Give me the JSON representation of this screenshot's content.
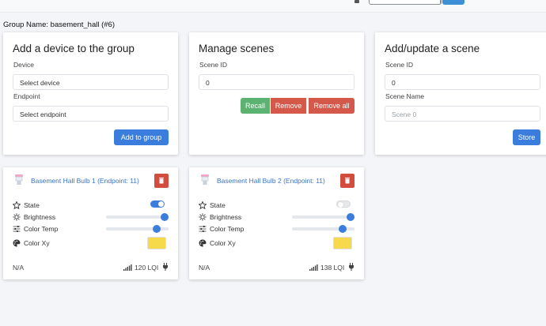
{
  "group_name": "Group Name: basement_hall (#6)",
  "add_device": {
    "title": "Add a device to the group",
    "device_label": "Device",
    "device_value": "Select device",
    "endpoint_label": "Endpoint",
    "endpoint_value": "Select endpoint",
    "button": "Add to group"
  },
  "manage_scenes": {
    "title": "Manage scenes",
    "scene_id_label": "Scene ID",
    "scene_id_value": "0",
    "recall": "Recall",
    "remove": "Remove",
    "remove_all": "Remove all"
  },
  "update_scene": {
    "title": "Add/update a scene",
    "scene_id_label": "Scene ID",
    "scene_id_value": "0",
    "scene_name_label": "Scene Name",
    "scene_name_placeholder": "Scene 0",
    "button": "Store"
  },
  "devices": [
    {
      "title": "Basement Hall Bulb 1 (Endpoint: 11)",
      "state_label": "State",
      "state_on": true,
      "brightness_label": "Brightness",
      "brightness": 1.0,
      "color_temp_label": "Color Temp",
      "color_temp": 0.86,
      "color_xy_label": "Color Xy",
      "color": "#f7d94c",
      "status": "N/A",
      "lqi": "120 LQI"
    },
    {
      "title": "Basement Hall Bulb 2 (Endpoint: 11)",
      "state_label": "State",
      "state_on": false,
      "brightness_label": "Brightness",
      "brightness": 1.0,
      "color_temp_label": "Color Temp",
      "color_temp": 0.86,
      "color_xy_label": "Color Xy",
      "color": "#f7d94c",
      "status": "N/A",
      "lqi": "138 LQI"
    }
  ],
  "colors": {
    "primary": "#3b7ddd",
    "success": "#5cb270",
    "danger": "#d5594b"
  }
}
